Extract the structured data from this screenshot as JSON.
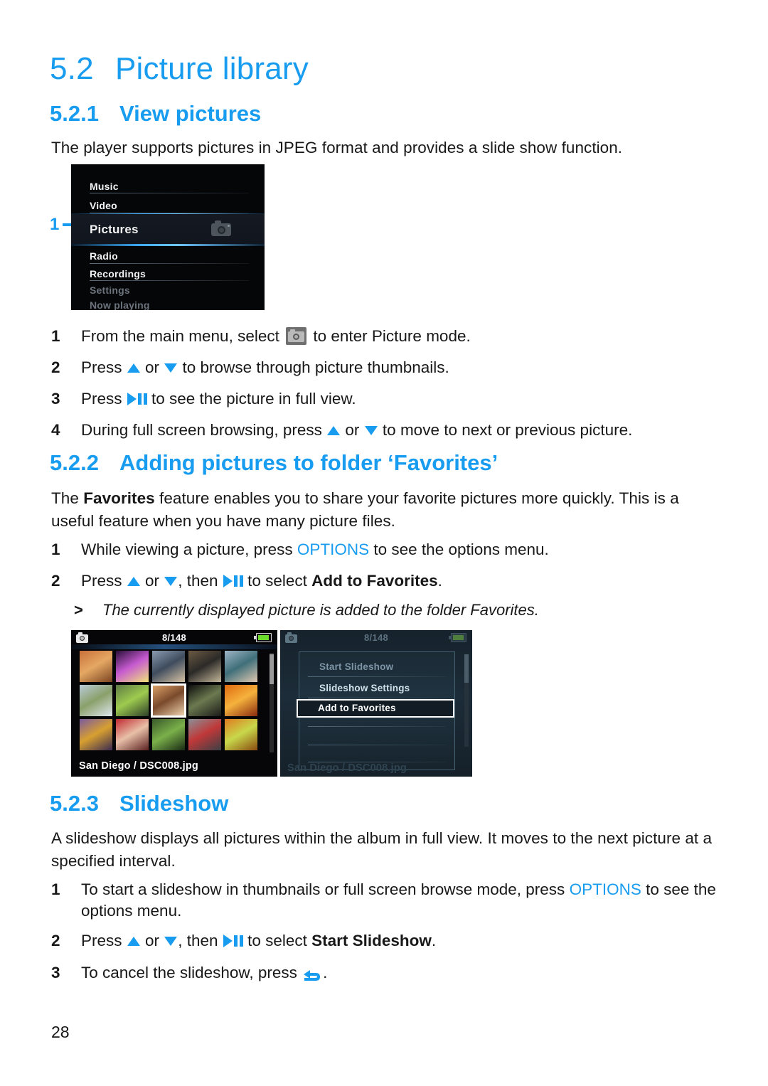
{
  "section": {
    "number": "5.2",
    "title": "Picture library"
  },
  "sub1": {
    "number": "5.2.1",
    "title": "View pictures",
    "intro": "The player supports pictures in JPEG format and provides a slide show function.",
    "steps": [
      {
        "n": "1",
        "a": "From the main menu, select ",
        "b": " to enter Picture mode."
      },
      {
        "n": "2",
        "a": "Press ",
        "b": " or ",
        "c": " to browse through picture thumbnails."
      },
      {
        "n": "3",
        "a": "Press ",
        "b": " to see the picture in full view."
      },
      {
        "n": "4",
        "a": "During full screen browsing, press ",
        "b": " or ",
        "c": " to move to next or previous picture."
      }
    ]
  },
  "sub2": {
    "number": "5.2.2",
    "title": "Adding pictures to folder ‘Favorites’",
    "body_a": "The ",
    "body_bold": "Favorites",
    "body_b": " feature enables you to share your favorite pictures more quickly. This is a useful feature when you have many picture files.",
    "steps": [
      {
        "n": "1",
        "a": "While viewing a picture, press ",
        "options": "OPTIONS",
        "b": " to see the options menu."
      },
      {
        "n": "2",
        "a": "Press ",
        "b": " or ",
        "c": ", then ",
        "d": " to select ",
        "bold": "Add to Favorites",
        "e": "."
      }
    ],
    "result_marker": ">",
    "result": "The currently displayed picture is added to the folder Favorites."
  },
  "sub3": {
    "number": "5.2.3",
    "title": "Slideshow",
    "body": "A slideshow displays all pictures within the album in full view. It moves to the next picture at a specified interval.",
    "steps": [
      {
        "n": "1",
        "a": "To start a slideshow in thumbnails or full screen browse mode, press ",
        "options": "OPTIONS",
        "b": " to see the options menu."
      },
      {
        "n": "2",
        "a": "Press ",
        "b": " or ",
        "c": ", then ",
        "d": " to select ",
        "bold": "Start Slideshow",
        "e": "."
      },
      {
        "n": "3",
        "a": "To cancel the slideshow, press ",
        "b": "."
      }
    ]
  },
  "device_menu": {
    "callout": "1",
    "items": [
      {
        "label": "Music",
        "state": "normal"
      },
      {
        "label": "Video",
        "state": "normal"
      },
      {
        "label": "Pictures",
        "state": "selected",
        "icon": "camera-icon"
      },
      {
        "label": "Radio",
        "state": "normal"
      },
      {
        "label": "Recordings",
        "state": "normal"
      },
      {
        "label": "Settings",
        "state": "dimmed"
      },
      {
        "label": "Now playing",
        "state": "dimmed"
      }
    ]
  },
  "device_thumbnails": {
    "counter": "8/148",
    "filename": "San Diego / DSC008.jpg",
    "selected_index": 7,
    "thumbs": [
      {
        "c1": "#c8703a",
        "c2": "#e5a863",
        "c3": "#7a4422"
      },
      {
        "c1": "#2a0f3a",
        "c2": "#c65ad0",
        "c3": "#f0e27a"
      },
      {
        "c1": "#8a9bb0",
        "c2": "#3f4c5e",
        "c3": "#d8c3a4"
      },
      {
        "c1": "#6a5a42",
        "c2": "#2c2a28",
        "c3": "#c4b79a"
      },
      {
        "c1": "#9fb4c6",
        "c2": "#3f6f7a",
        "c3": "#e0c8b0"
      },
      {
        "c1": "#b9cbd9",
        "c2": "#8aa06a",
        "c3": "#dfe8ef"
      },
      {
        "c1": "#5d7a45",
        "c2": "#9ecb4f",
        "c3": "#2e3f28"
      },
      {
        "c1": "#e0a56a",
        "c2": "#7a4a2c",
        "c3": "#f3d8b4"
      },
      {
        "c1": "#0d0d0d",
        "c2": "#6c7a50",
        "c3": "#1a1a18"
      },
      {
        "c1": "#e06a10",
        "c2": "#f5b23c",
        "c3": "#8a2a10"
      },
      {
        "c1": "#7a5aa0",
        "c2": "#d8a030",
        "c3": "#3a2a50"
      },
      {
        "c1": "#c02a30",
        "c2": "#e8c0a8",
        "c3": "#5a2020"
      },
      {
        "c1": "#3a5a2a",
        "c2": "#7ab04a",
        "c3": "#1a2a14"
      },
      {
        "c1": "#8a9098",
        "c2": "#c03838",
        "c3": "#3a4046"
      },
      {
        "c1": "#e07a20",
        "c2": "#c8d84a",
        "c3": "#8a4a10"
      }
    ]
  },
  "device_options": {
    "counter": "8/148",
    "ghost_filename": "San Diego / DSC008.jpg",
    "items": [
      {
        "label": "Start Slideshow",
        "state": "dimmed"
      },
      {
        "label": "Slideshow Settings",
        "state": "normal"
      },
      {
        "label": "Add to Favorites",
        "state": "selected"
      }
    ]
  },
  "footer": {
    "page_number": "28"
  },
  "colors": {
    "accent_blue": "#189CF0",
    "text": "#181818",
    "battery_green": "#6ddb2c"
  }
}
